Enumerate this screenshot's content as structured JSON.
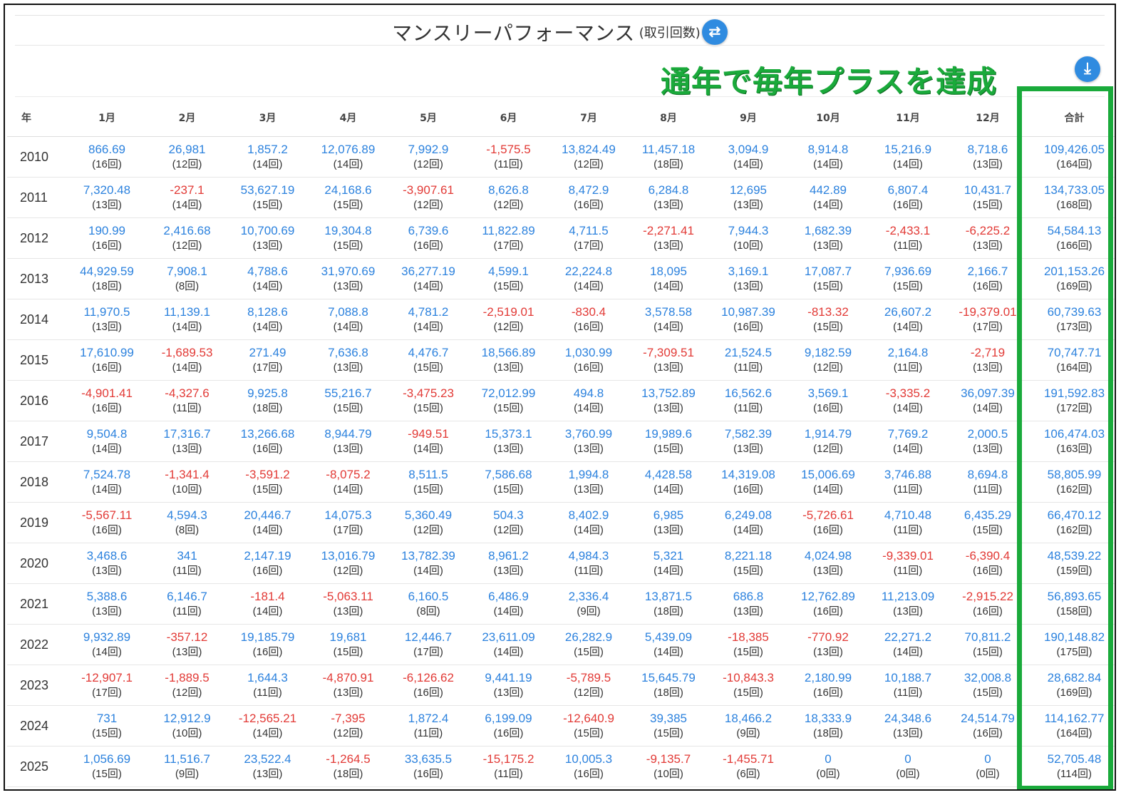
{
  "title": "マンスリーパフォーマンス",
  "title_sub": "(取引回数)",
  "swap_icon": "⇄",
  "download_icon": "⤓",
  "banner": "通年で毎年プラスを達成",
  "colors": {
    "positive": "#2c82de",
    "negative": "#e23a36",
    "highlight": "#1aaa3b",
    "button": "#2f8be0"
  },
  "headers": [
    "年",
    "1月",
    "2月",
    "3月",
    "4月",
    "5月",
    "6月",
    "7月",
    "8月",
    "9月",
    "10月",
    "11月",
    "12月",
    "合計"
  ],
  "rows": [
    {
      "year": "2010",
      "cells": [
        [
          "866.69",
          "(16回)"
        ],
        [
          "26,981",
          "(12回)"
        ],
        [
          "1,857.2",
          "(14回)"
        ],
        [
          "12,076.89",
          "(14回)"
        ],
        [
          "7,992.9",
          "(12回)"
        ],
        [
          "-1,575.5",
          "(11回)"
        ],
        [
          "13,824.49",
          "(12回)"
        ],
        [
          "11,457.18",
          "(18回)"
        ],
        [
          "3,094.9",
          "(14回)"
        ],
        [
          "8,914.8",
          "(14回)"
        ],
        [
          "15,216.9",
          "(14回)"
        ],
        [
          "8,718.6",
          "(13回)"
        ],
        [
          "109,426.05",
          "(164回)"
        ]
      ]
    },
    {
      "year": "2011",
      "cells": [
        [
          "7,320.48",
          "(13回)"
        ],
        [
          "-237.1",
          "(14回)"
        ],
        [
          "53,627.19",
          "(15回)"
        ],
        [
          "24,168.6",
          "(15回)"
        ],
        [
          "-3,907.61",
          "(12回)"
        ],
        [
          "8,626.8",
          "(12回)"
        ],
        [
          "8,472.9",
          "(16回)"
        ],
        [
          "6,284.8",
          "(13回)"
        ],
        [
          "12,695",
          "(13回)"
        ],
        [
          "442.89",
          "(14回)"
        ],
        [
          "6,807.4",
          "(16回)"
        ],
        [
          "10,431.7",
          "(15回)"
        ],
        [
          "134,733.05",
          "(168回)"
        ]
      ]
    },
    {
      "year": "2012",
      "cells": [
        [
          "190.99",
          "(16回)"
        ],
        [
          "2,416.68",
          "(12回)"
        ],
        [
          "10,700.69",
          "(13回)"
        ],
        [
          "19,304.8",
          "(15回)"
        ],
        [
          "6,739.6",
          "(16回)"
        ],
        [
          "11,822.89",
          "(17回)"
        ],
        [
          "4,711.5",
          "(17回)"
        ],
        [
          "-2,271.41",
          "(13回)"
        ],
        [
          "7,944.3",
          "(10回)"
        ],
        [
          "1,682.39",
          "(13回)"
        ],
        [
          "-2,433.1",
          "(11回)"
        ],
        [
          "-6,225.2",
          "(13回)"
        ],
        [
          "54,584.13",
          "(166回)"
        ]
      ]
    },
    {
      "year": "2013",
      "cells": [
        [
          "44,929.59",
          "(18回)"
        ],
        [
          "7,908.1",
          "(8回)"
        ],
        [
          "4,788.6",
          "(14回)"
        ],
        [
          "31,970.69",
          "(13回)"
        ],
        [
          "36,277.19",
          "(14回)"
        ],
        [
          "4,599.1",
          "(15回)"
        ],
        [
          "22,224.8",
          "(14回)"
        ],
        [
          "18,095",
          "(14回)"
        ],
        [
          "3,169.1",
          "(13回)"
        ],
        [
          "17,087.7",
          "(15回)"
        ],
        [
          "7,936.69",
          "(15回)"
        ],
        [
          "2,166.7",
          "(16回)"
        ],
        [
          "201,153.26",
          "(169回)"
        ]
      ]
    },
    {
      "year": "2014",
      "cells": [
        [
          "11,970.5",
          "(13回)"
        ],
        [
          "11,139.1",
          "(14回)"
        ],
        [
          "8,128.6",
          "(14回)"
        ],
        [
          "7,088.8",
          "(14回)"
        ],
        [
          "4,781.2",
          "(14回)"
        ],
        [
          "-2,519.01",
          "(12回)"
        ],
        [
          "-830.4",
          "(16回)"
        ],
        [
          "3,578.58",
          "(14回)"
        ],
        [
          "10,987.39",
          "(16回)"
        ],
        [
          "-813.32",
          "(15回)"
        ],
        [
          "26,607.2",
          "(14回)"
        ],
        [
          "-19,379.01",
          "(17回)"
        ],
        [
          "60,739.63",
          "(173回)"
        ]
      ]
    },
    {
      "year": "2015",
      "cells": [
        [
          "17,610.99",
          "(16回)"
        ],
        [
          "-1,689.53",
          "(14回)"
        ],
        [
          "271.49",
          "(17回)"
        ],
        [
          "7,636.8",
          "(13回)"
        ],
        [
          "4,476.7",
          "(15回)"
        ],
        [
          "18,566.89",
          "(13回)"
        ],
        [
          "1,030.99",
          "(16回)"
        ],
        [
          "-7,309.51",
          "(13回)"
        ],
        [
          "21,524.5",
          "(11回)"
        ],
        [
          "9,182.59",
          "(12回)"
        ],
        [
          "2,164.8",
          "(11回)"
        ],
        [
          "-2,719",
          "(13回)"
        ],
        [
          "70,747.71",
          "(164回)"
        ]
      ]
    },
    {
      "year": "2016",
      "cells": [
        [
          "-4,901.41",
          "(16回)"
        ],
        [
          "-4,327.6",
          "(11回)"
        ],
        [
          "9,925.8",
          "(18回)"
        ],
        [
          "55,216.7",
          "(15回)"
        ],
        [
          "-3,475.23",
          "(15回)"
        ],
        [
          "72,012.99",
          "(15回)"
        ],
        [
          "494.8",
          "(14回)"
        ],
        [
          "13,752.89",
          "(13回)"
        ],
        [
          "16,562.6",
          "(11回)"
        ],
        [
          "3,569.1",
          "(16回)"
        ],
        [
          "-3,335.2",
          "(14回)"
        ],
        [
          "36,097.39",
          "(14回)"
        ],
        [
          "191,592.83",
          "(172回)"
        ]
      ]
    },
    {
      "year": "2017",
      "cells": [
        [
          "9,504.8",
          "(14回)"
        ],
        [
          "17,316.7",
          "(13回)"
        ],
        [
          "13,266.68",
          "(16回)"
        ],
        [
          "8,944.79",
          "(13回)"
        ],
        [
          "-949.51",
          "(14回)"
        ],
        [
          "15,373.1",
          "(13回)"
        ],
        [
          "3,760.99",
          "(13回)"
        ],
        [
          "19,989.6",
          "(15回)"
        ],
        [
          "7,582.39",
          "(13回)"
        ],
        [
          "1,914.79",
          "(12回)"
        ],
        [
          "7,769.2",
          "(14回)"
        ],
        [
          "2,000.5",
          "(13回)"
        ],
        [
          "106,474.03",
          "(163回)"
        ]
      ]
    },
    {
      "year": "2018",
      "cells": [
        [
          "7,524.78",
          "(14回)"
        ],
        [
          "-1,341.4",
          "(10回)"
        ],
        [
          "-3,591.2",
          "(15回)"
        ],
        [
          "-8,075.2",
          "(14回)"
        ],
        [
          "8,511.5",
          "(15回)"
        ],
        [
          "7,586.68",
          "(15回)"
        ],
        [
          "1,994.8",
          "(13回)"
        ],
        [
          "4,428.58",
          "(14回)"
        ],
        [
          "14,319.08",
          "(16回)"
        ],
        [
          "15,006.69",
          "(14回)"
        ],
        [
          "3,746.88",
          "(11回)"
        ],
        [
          "8,694.8",
          "(11回)"
        ],
        [
          "58,805.99",
          "(162回)"
        ]
      ]
    },
    {
      "year": "2019",
      "cells": [
        [
          "-5,567.11",
          "(16回)"
        ],
        [
          "4,594.3",
          "(8回)"
        ],
        [
          "20,446.7",
          "(14回)"
        ],
        [
          "14,075.3",
          "(17回)"
        ],
        [
          "5,360.49",
          "(12回)"
        ],
        [
          "504.3",
          "(12回)"
        ],
        [
          "8,402.9",
          "(14回)"
        ],
        [
          "6,985",
          "(13回)"
        ],
        [
          "6,249.08",
          "(14回)"
        ],
        [
          "-5,726.61",
          "(16回)"
        ],
        [
          "4,710.48",
          "(11回)"
        ],
        [
          "6,435.29",
          "(15回)"
        ],
        [
          "66,470.12",
          "(162回)"
        ]
      ]
    },
    {
      "year": "2020",
      "cells": [
        [
          "3,468.6",
          "(13回)"
        ],
        [
          "341",
          "(11回)"
        ],
        [
          "2,147.19",
          "(16回)"
        ],
        [
          "13,016.79",
          "(12回)"
        ],
        [
          "13,782.39",
          "(14回)"
        ],
        [
          "8,961.2",
          "(13回)"
        ],
        [
          "4,984.3",
          "(11回)"
        ],
        [
          "5,321",
          "(14回)"
        ],
        [
          "8,221.18",
          "(15回)"
        ],
        [
          "4,024.98",
          "(13回)"
        ],
        [
          "-9,339.01",
          "(11回)"
        ],
        [
          "-6,390.4",
          "(16回)"
        ],
        [
          "48,539.22",
          "(159回)"
        ]
      ]
    },
    {
      "year": "2021",
      "cells": [
        [
          "5,388.6",
          "(13回)"
        ],
        [
          "6,146.7",
          "(11回)"
        ],
        [
          "-181.4",
          "(14回)"
        ],
        [
          "-5,063.11",
          "(13回)"
        ],
        [
          "6,160.5",
          "(8回)"
        ],
        [
          "6,486.9",
          "(14回)"
        ],
        [
          "2,336.4",
          "(9回)"
        ],
        [
          "13,871.5",
          "(18回)"
        ],
        [
          "686.8",
          "(13回)"
        ],
        [
          "12,762.89",
          "(16回)"
        ],
        [
          "11,213.09",
          "(13回)"
        ],
        [
          "-2,915.22",
          "(16回)"
        ],
        [
          "56,893.65",
          "(158回)"
        ]
      ]
    },
    {
      "year": "2022",
      "cells": [
        [
          "9,932.89",
          "(14回)"
        ],
        [
          "-357.12",
          "(13回)"
        ],
        [
          "19,185.79",
          "(16回)"
        ],
        [
          "19,681",
          "(15回)"
        ],
        [
          "12,446.7",
          "(17回)"
        ],
        [
          "23,611.09",
          "(14回)"
        ],
        [
          "26,282.9",
          "(15回)"
        ],
        [
          "5,439.09",
          "(14回)"
        ],
        [
          "-18,385",
          "(15回)"
        ],
        [
          "-770.92",
          "(13回)"
        ],
        [
          "22,271.2",
          "(14回)"
        ],
        [
          "70,811.2",
          "(15回)"
        ],
        [
          "190,148.82",
          "(175回)"
        ]
      ]
    },
    {
      "year": "2023",
      "cells": [
        [
          "-12,907.1",
          "(17回)"
        ],
        [
          "-1,889.5",
          "(12回)"
        ],
        [
          "1,644.3",
          "(11回)"
        ],
        [
          "-4,870.91",
          "(13回)"
        ],
        [
          "-6,126.62",
          "(16回)"
        ],
        [
          "9,441.19",
          "(13回)"
        ],
        [
          "-5,789.5",
          "(12回)"
        ],
        [
          "15,645.79",
          "(18回)"
        ],
        [
          "-10,843.3",
          "(15回)"
        ],
        [
          "2,180.99",
          "(16回)"
        ],
        [
          "10,188.7",
          "(11回)"
        ],
        [
          "32,008.8",
          "(15回)"
        ],
        [
          "28,682.84",
          "(169回)"
        ]
      ]
    },
    {
      "year": "2024",
      "cells": [
        [
          "731",
          "(15回)"
        ],
        [
          "12,912.9",
          "(10回)"
        ],
        [
          "-12,565.21",
          "(14回)"
        ],
        [
          "-7,395",
          "(12回)"
        ],
        [
          "1,872.4",
          "(11回)"
        ],
        [
          "6,199.09",
          "(16回)"
        ],
        [
          "-12,640.9",
          "(15回)"
        ],
        [
          "39,385",
          "(15回)"
        ],
        [
          "18,466.2",
          "(9回)"
        ],
        [
          "18,333.9",
          "(18回)"
        ],
        [
          "24,348.6",
          "(13回)"
        ],
        [
          "24,514.79",
          "(16回)"
        ],
        [
          "114,162.77",
          "(164回)"
        ]
      ]
    },
    {
      "year": "2025",
      "cells": [
        [
          "1,056.69",
          "(15回)"
        ],
        [
          "11,516.7",
          "(9回)"
        ],
        [
          "23,522.4",
          "(13回)"
        ],
        [
          "-1,264.5",
          "(18回)"
        ],
        [
          "33,635.5",
          "(16回)"
        ],
        [
          "-15,175.2",
          "(11回)"
        ],
        [
          "10,005.3",
          "(16回)"
        ],
        [
          "-9,135.7",
          "(10回)"
        ],
        [
          "-1,455.71",
          "(6回)"
        ],
        [
          "0",
          "(0回)"
        ],
        [
          "0",
          "(0回)"
        ],
        [
          "0",
          "(0回)"
        ],
        [
          "52,705.48",
          "(114回)"
        ]
      ]
    }
  ]
}
